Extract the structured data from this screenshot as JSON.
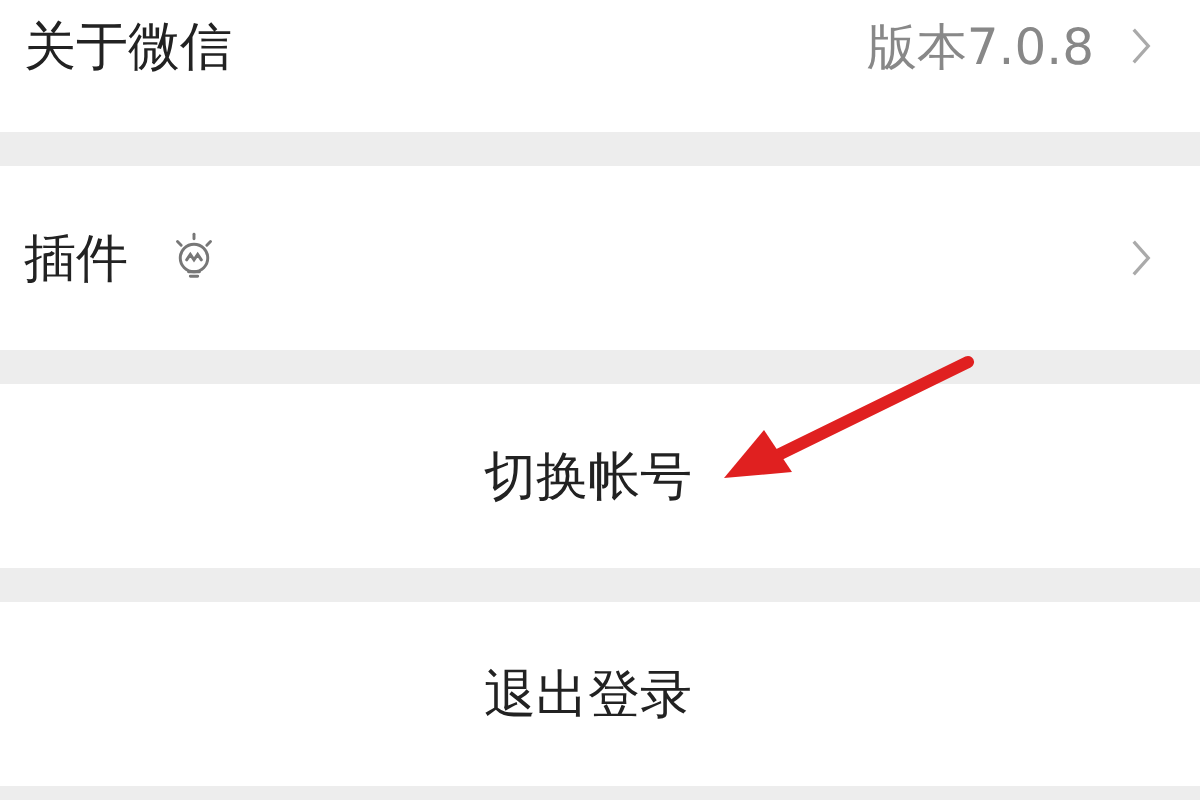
{
  "rows": [
    {
      "kind": "nav",
      "label": "关于微信",
      "value": "版本7.0.8",
      "icon": false
    },
    {
      "kind": "nav",
      "label": "插件",
      "icon": true
    },
    {
      "kind": "action",
      "label": "切换帐号"
    },
    {
      "kind": "action",
      "label": "退出登录"
    }
  ]
}
